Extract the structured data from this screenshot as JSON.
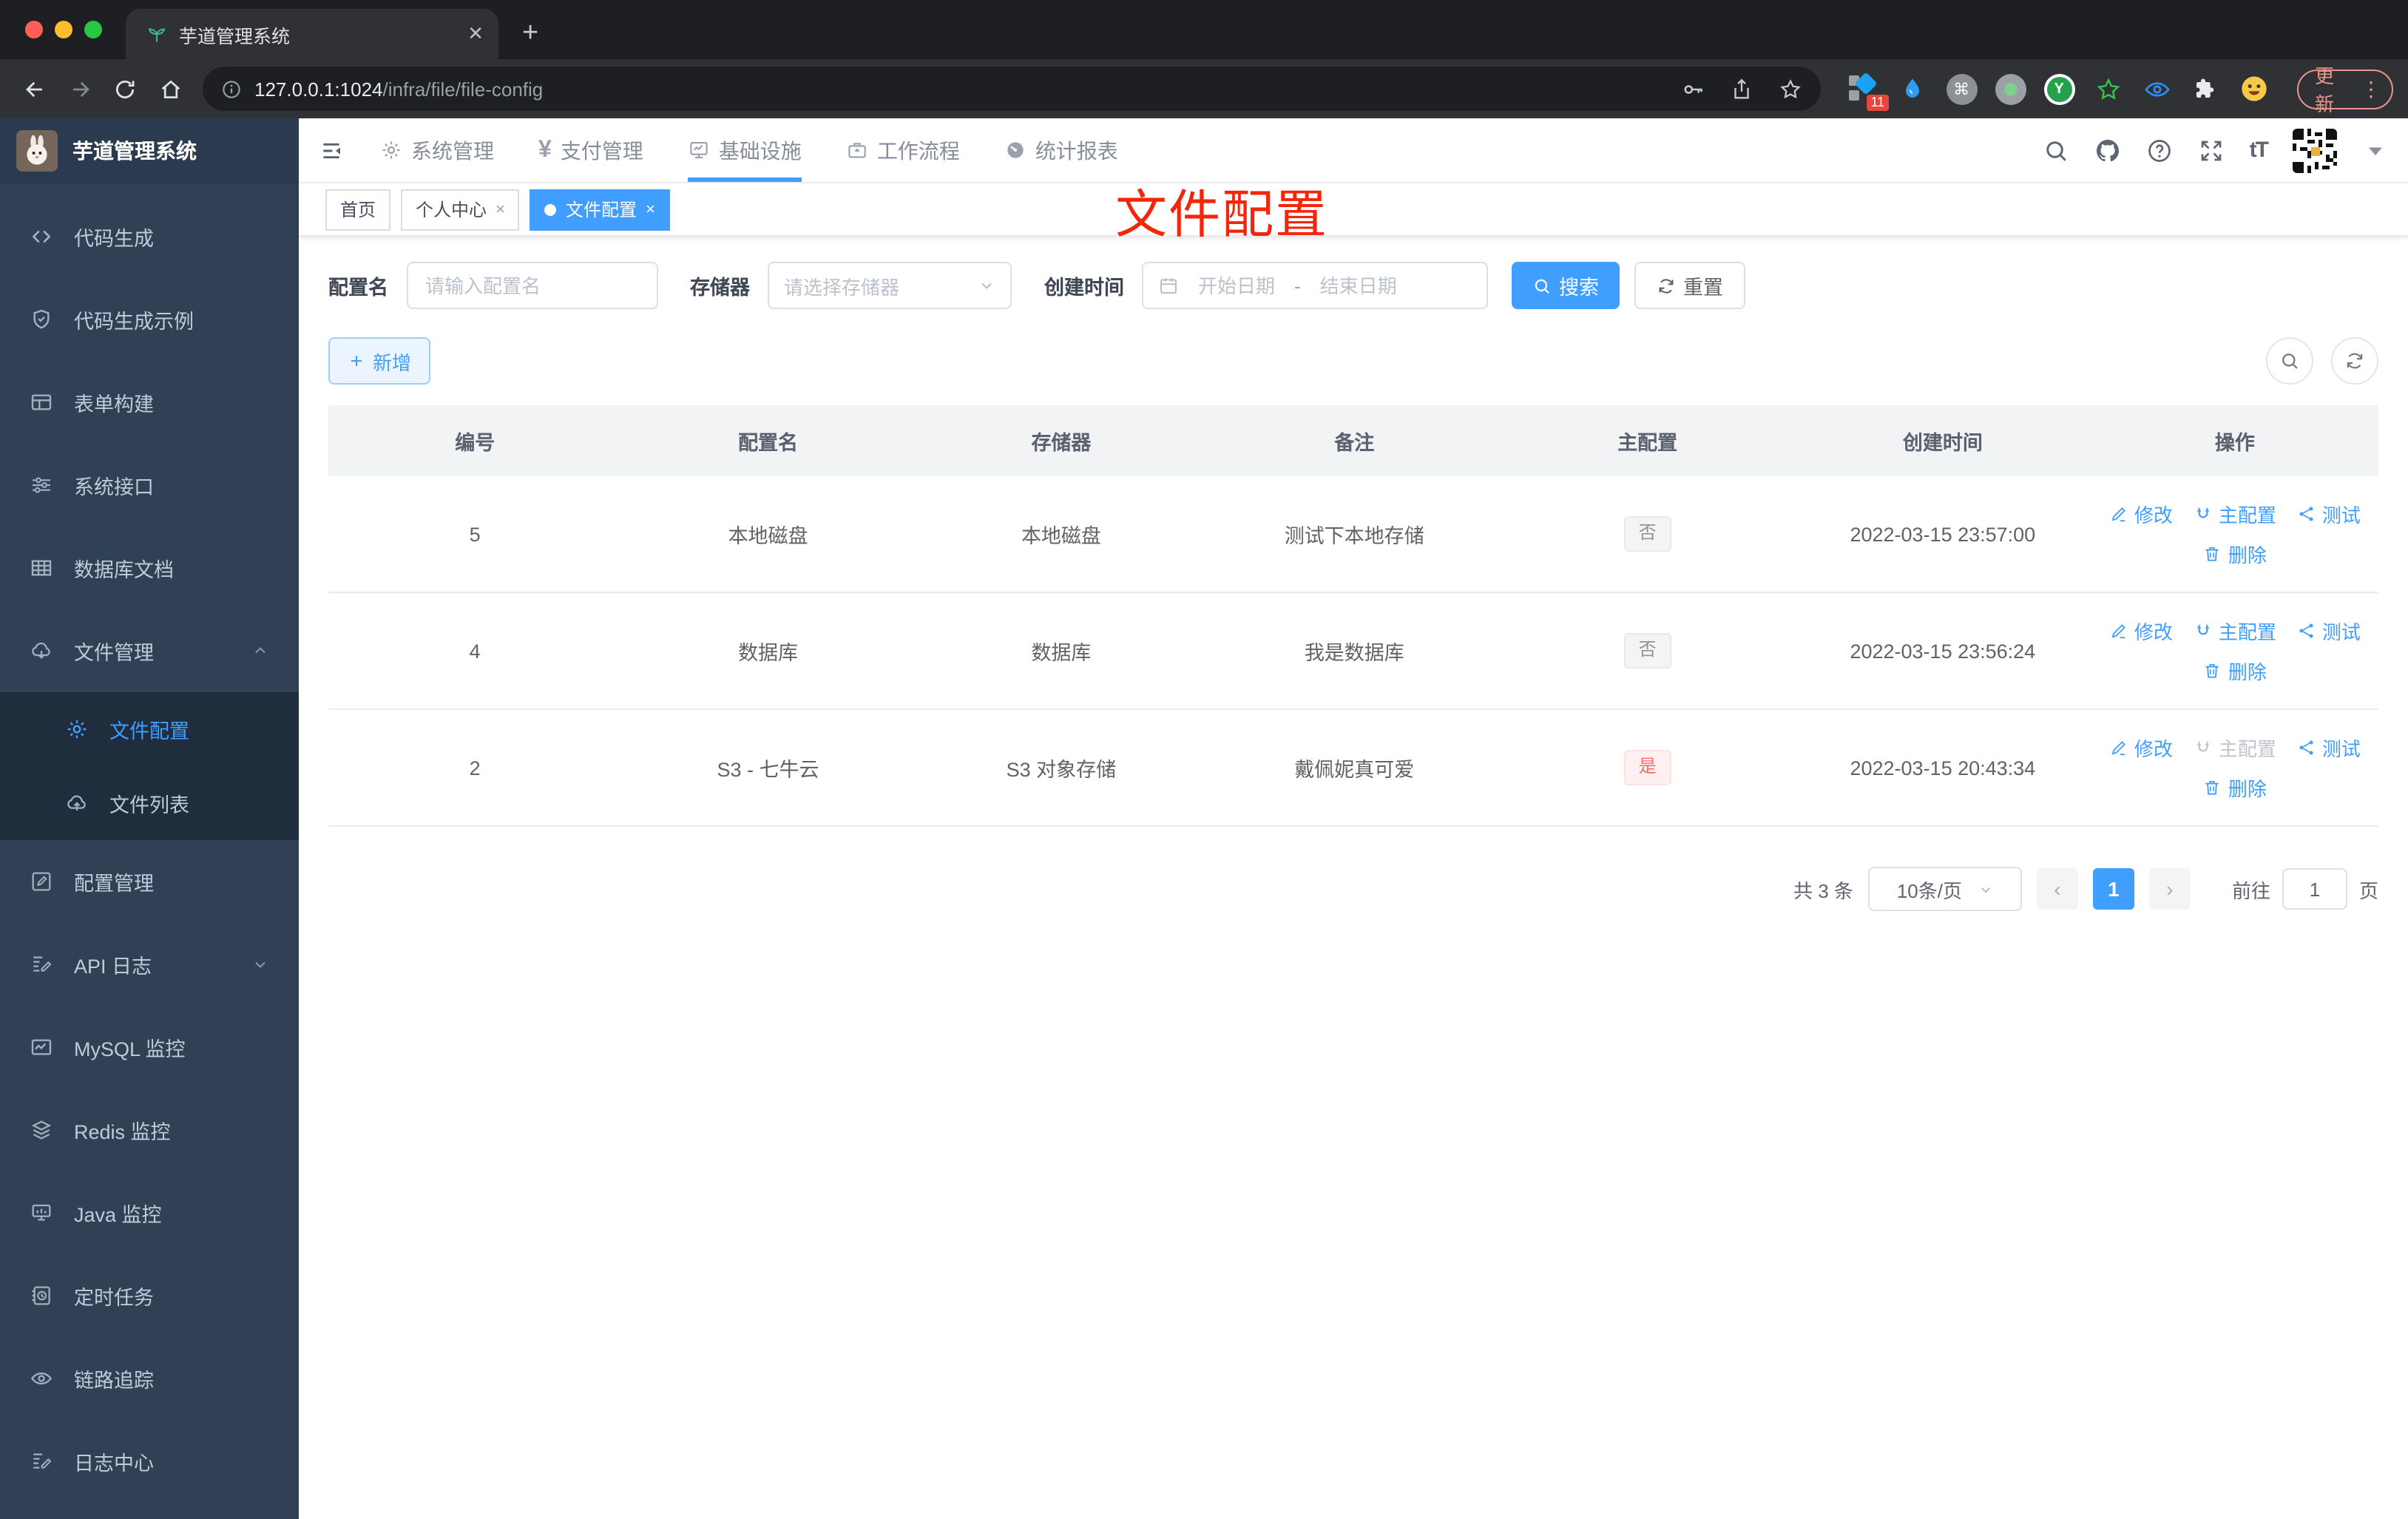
{
  "browser": {
    "tab_title": "芋道管理系统",
    "close_glyph": "✕",
    "new_tab_glyph": "+",
    "url_host": "127.0.0.1:1024",
    "url_path": "/infra/file/file-config",
    "extensions_badge": "11",
    "cmd_glyph": "⌘",
    "ext_y_label": "Y",
    "update_label": "更新",
    "kebab_glyph": "⋮"
  },
  "header": {
    "logo_title": "芋道管理系统",
    "nav": [
      {
        "label": "系统管理"
      },
      {
        "label": "支付管理",
        "glyph": "¥"
      },
      {
        "label": "基础设施"
      },
      {
        "label": "工作流程"
      },
      {
        "label": "统计报表"
      }
    ],
    "font_size_glyph": "tT"
  },
  "sidebar": {
    "items": [
      {
        "label": "代码生成"
      },
      {
        "label": "代码生成示例"
      },
      {
        "label": "表单构建"
      },
      {
        "label": "系统接口"
      },
      {
        "label": "数据库文档"
      },
      {
        "label": "文件管理",
        "children": [
          {
            "label": "文件配置"
          },
          {
            "label": "文件列表"
          }
        ]
      },
      {
        "label": "配置管理"
      },
      {
        "label": "API 日志"
      },
      {
        "label": "MySQL 监控"
      },
      {
        "label": "Redis 监控"
      },
      {
        "label": "Java 监控"
      },
      {
        "label": "定时任务"
      },
      {
        "label": "链路追踪"
      },
      {
        "label": "日志中心"
      }
    ]
  },
  "tags": [
    {
      "label": "首页"
    },
    {
      "label": "个人中心",
      "close": "×"
    },
    {
      "label": "文件配置",
      "close": "×"
    }
  ],
  "overlay_title": "文件配置",
  "filter": {
    "name_label": "配置名",
    "name_placeholder": "请输入配置名",
    "storage_label": "存储器",
    "storage_placeholder": "请选择存储器",
    "time_label": "创建时间",
    "start_placeholder": "开始日期",
    "separator": "-",
    "end_placeholder": "结束日期",
    "search_label": "搜索",
    "reset_label": "重置"
  },
  "toolbar": {
    "add_label": "新增"
  },
  "table": {
    "columns": [
      "编号",
      "配置名",
      "存储器",
      "备注",
      "主配置",
      "创建时间",
      "操作"
    ],
    "actions": {
      "edit": "修改",
      "master": "主配置",
      "test": "测试",
      "delete": "删除"
    },
    "rows": [
      {
        "id": "5",
        "name": "本地磁盘",
        "storage": "本地磁盘",
        "remark": "测试下本地存储",
        "master": "否",
        "time": "2022-03-15 23:57:00"
      },
      {
        "id": "4",
        "name": "数据库",
        "storage": "数据库",
        "remark": "我是数据库",
        "master": "否",
        "time": "2022-03-15 23:56:24"
      },
      {
        "id": "2",
        "name": "S3 - 七牛云",
        "storage": "S3 对象存储",
        "remark": "戴佩妮真可爱",
        "master": "是",
        "time": "2022-03-15 20:43:34"
      }
    ]
  },
  "pagination": {
    "total": "共 3 条",
    "page_size": "10条/页",
    "prev_glyph": "‹",
    "page": "1",
    "next_glyph": "›",
    "goto_label": "前往",
    "goto_value": "1",
    "page_unit": "页"
  },
  "colors": {
    "accent": "#409eff",
    "danger": "#f56c6c",
    "overlay_red": "#f5250b",
    "sidebar_bg": "#304156",
    "sidebar_sub_bg": "#1f2d3d"
  }
}
